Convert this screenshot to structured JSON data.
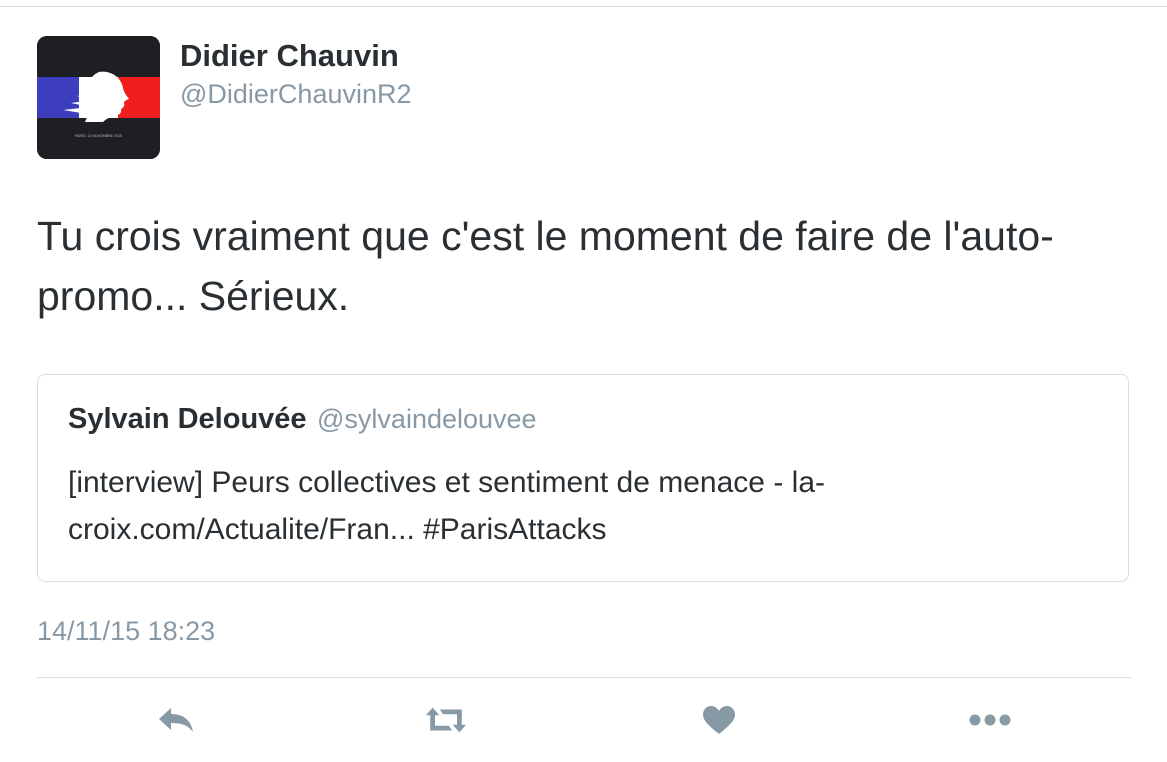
{
  "author": {
    "name": "Didier Chauvin",
    "handle": "@DidierChauvinR2",
    "avatar_caption": "PARIS, 13 NOVEMBRE 2015"
  },
  "tweet": {
    "text": "Tu crois vraiment que c'est le moment de faire de l'auto-promo... Sérieux.",
    "timestamp": "14/11/15 18:23"
  },
  "quoted_tweet": {
    "name": "Sylvain Delouvée",
    "handle": "@sylvaindelouvee",
    "text": "[interview] Peurs collectives et sentiment de menace - la-croix.com/Actualite/Fran... #ParisAttacks"
  },
  "actions": {
    "reply_icon": "reply-icon",
    "retweet_icon": "retweet-icon",
    "like_icon": "heart-icon",
    "more_icon": "more-icon"
  },
  "colors": {
    "text": "#292f33",
    "secondary": "#8899a6",
    "border": "#d8dde1",
    "icon": "#8899a6",
    "flag_blue": "#3d3ebd",
    "flag_red": "#f01e1e",
    "avatar_bg": "#1e1f22"
  }
}
